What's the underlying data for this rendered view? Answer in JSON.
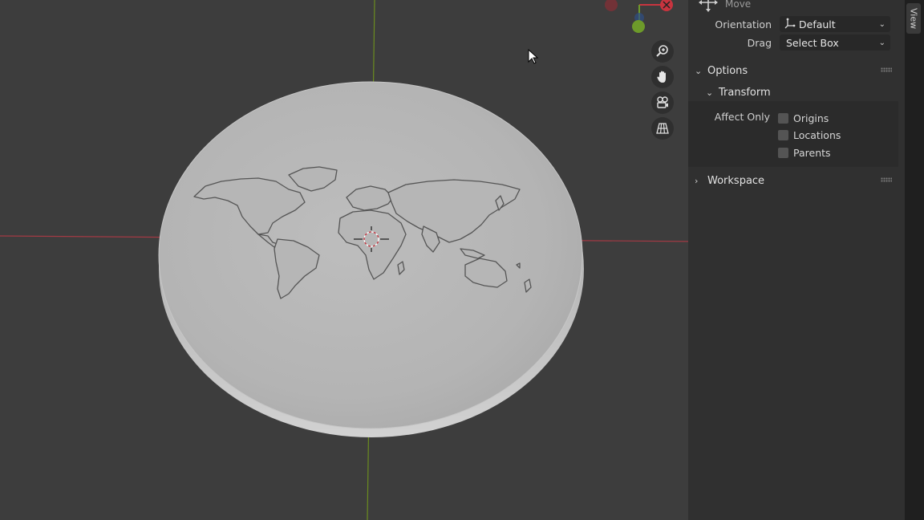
{
  "tool": {
    "name": "Move"
  },
  "tool_settings": {
    "orientation_label": "Orientation",
    "orientation_value": "Default",
    "drag_label": "Drag",
    "drag_value": "Select Box"
  },
  "panels": {
    "options_label": "Options",
    "transform_label": "Transform",
    "affect_only_label": "Affect Only",
    "checkboxes": [
      {
        "label": "Origins",
        "checked": false
      },
      {
        "label": "Locations",
        "checked": false
      },
      {
        "label": "Parents",
        "checked": false
      }
    ],
    "workspace_label": "Workspace"
  },
  "tabs": {
    "view": "View"
  },
  "icons": {
    "zoom": "zoom-icon",
    "pan": "hand-pan-icon",
    "camera": "camera-view-icon",
    "ortho": "perspective-grid-icon",
    "cursor": "3d-cursor-icon",
    "mouse": "mouse-pointer-icon"
  },
  "colors": {
    "viewport_bg": "#3d3d3d",
    "x_axis": "#a33a44",
    "y_axis": "#6b8c1f",
    "gizmo_x": "#c8343f",
    "gizmo_y": "#6d9a2a",
    "gizmo_z": "#3a6fd0",
    "sidebar_bg": "#303030"
  }
}
